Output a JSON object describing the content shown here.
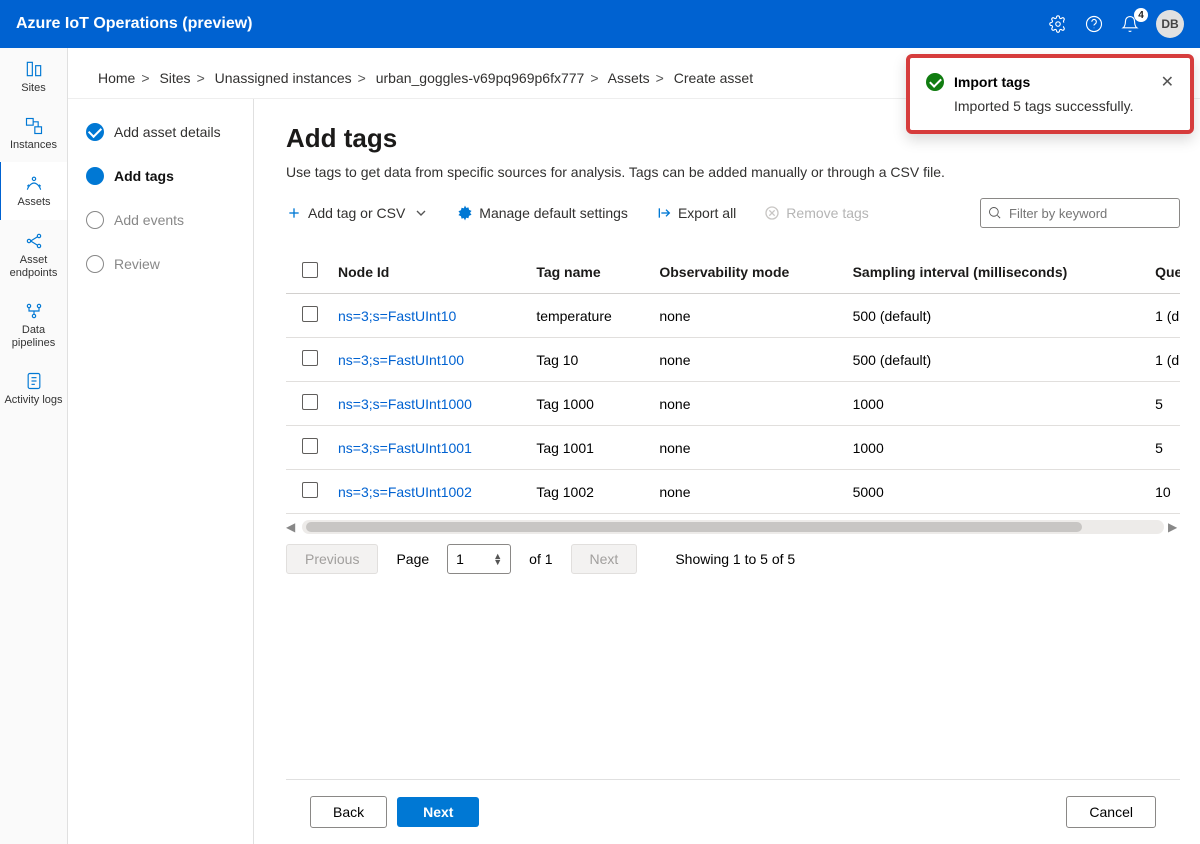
{
  "header": {
    "app_title": "Azure IoT Operations (preview)",
    "notification_count": "4",
    "avatar_initials": "DB"
  },
  "left_rail": {
    "items": [
      {
        "label": "Sites"
      },
      {
        "label": "Instances"
      },
      {
        "label": "Assets"
      },
      {
        "label": "Asset endpoints"
      },
      {
        "label": "Data pipelines"
      },
      {
        "label": "Activity logs"
      }
    ]
  },
  "breadcrumb": {
    "parts": [
      "Home",
      "Sites",
      "Unassigned instances",
      "urban_goggles-v69pq969p6fx777",
      "Assets",
      "Create asset"
    ]
  },
  "steps": [
    {
      "label": "Add asset details",
      "state": "done"
    },
    {
      "label": "Add tags",
      "state": "active"
    },
    {
      "label": "Add events",
      "state": "pending"
    },
    {
      "label": "Review",
      "state": "pending"
    }
  ],
  "page": {
    "title": "Add tags",
    "description": "Use tags to get data from specific sources for analysis. Tags can be added manually or through a CSV file.",
    "toolbar": {
      "add": "Add tag or CSV",
      "manage": "Manage default settings",
      "export": "Export all",
      "remove": "Remove tags",
      "filter_placeholder": "Filter by keyword"
    },
    "columns": {
      "node": "Node Id",
      "tagname": "Tag name",
      "obs": "Observability mode",
      "sampling": "Sampling interval (milliseconds)",
      "queue": "Que"
    },
    "rows": [
      {
        "node": "ns=3;s=FastUInt10",
        "tag": "temperature",
        "obs": "none",
        "sampling": "500 (default)",
        "queue": "1 (d"
      },
      {
        "node": "ns=3;s=FastUInt100",
        "tag": "Tag 10",
        "obs": "none",
        "sampling": "500 (default)",
        "queue": "1 (d"
      },
      {
        "node": "ns=3;s=FastUInt1000",
        "tag": "Tag 1000",
        "obs": "none",
        "sampling": "1000",
        "queue": "5"
      },
      {
        "node": "ns=3;s=FastUInt1001",
        "tag": "Tag 1001",
        "obs": "none",
        "sampling": "1000",
        "queue": "5"
      },
      {
        "node": "ns=3;s=FastUInt1002",
        "tag": "Tag 1002",
        "obs": "none",
        "sampling": "5000",
        "queue": "10"
      }
    ],
    "paging": {
      "previous": "Previous",
      "next": "Next",
      "page_label": "Page",
      "page_value": "1",
      "of_label": "of 1",
      "showing": "Showing 1 to 5 of 5"
    },
    "footer": {
      "back": "Back",
      "next": "Next",
      "cancel": "Cancel"
    }
  },
  "toast": {
    "title": "Import tags",
    "body": "Imported 5 tags successfully."
  }
}
